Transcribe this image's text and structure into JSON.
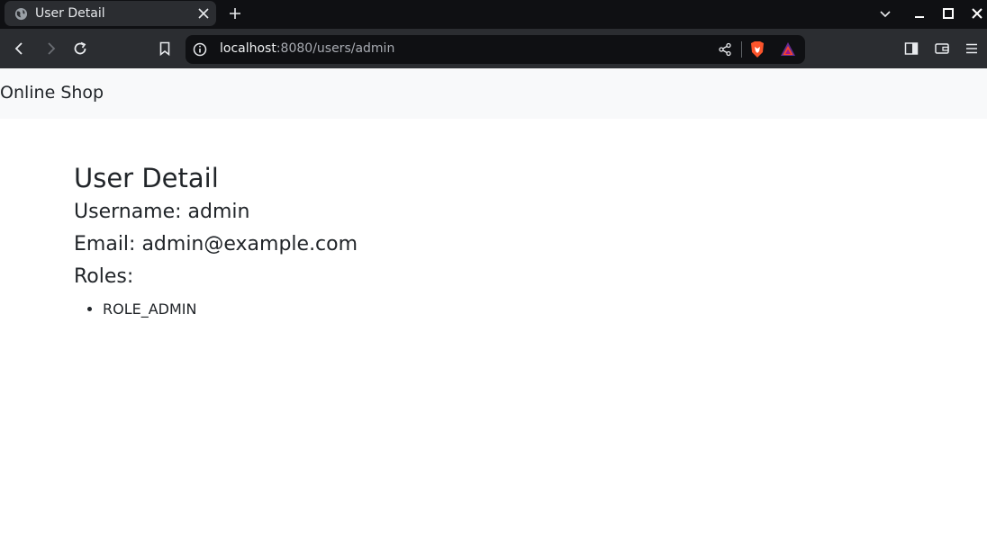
{
  "browser": {
    "tab_title": "User Detail",
    "url_host": "localhost",
    "url_rest": ":8080/users/admin"
  },
  "navbar": {
    "brand": "Online Shop"
  },
  "user": {
    "heading": "User Detail",
    "username_line": "Username: admin",
    "email_line": "Email: admin@example.com",
    "roles_label": "Roles:",
    "roles": [
      "ROLE_ADMIN"
    ]
  },
  "colors": {
    "tabbar_bg": "#0f1013",
    "toolbar_bg": "#2b2d31",
    "navbar_bg": "#f8f9fa",
    "text": "#212529",
    "brave_orange": "#fb542b"
  }
}
